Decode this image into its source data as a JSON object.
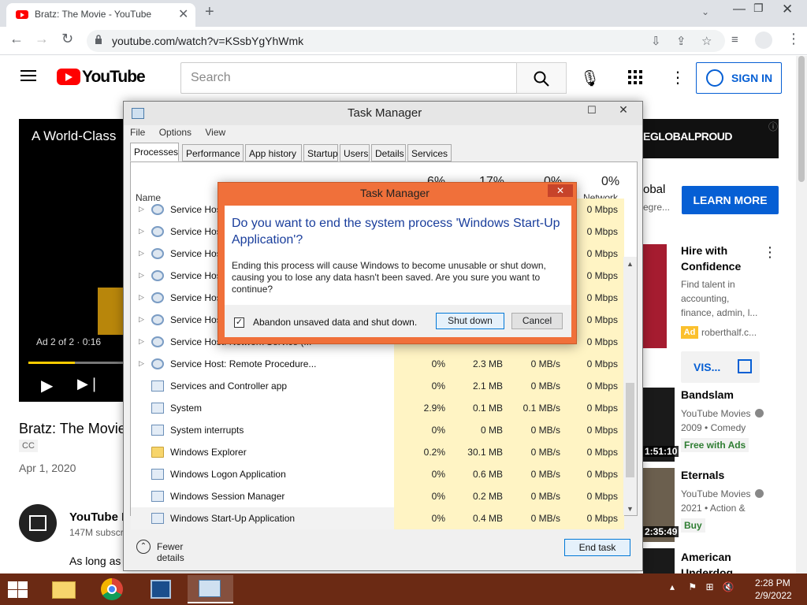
{
  "browser": {
    "tab_title": "Bratz: The Movie - YouTube",
    "url": "youtube.com/watch?v=KSsbYgYhWmk"
  },
  "youtube": {
    "wordmark": "YouTube",
    "search_placeholder": "Search",
    "sign_in": "SIGN IN",
    "player": {
      "ad_title": "A World-Class",
      "ad_counter": "Ad 2 of 2 · 0:16",
      "progress": 0.48
    },
    "video_title": "Bratz: The Movie",
    "cc_badge": "CC",
    "date": "Apr 1, 2020",
    "channel": {
      "name": "YouTube M",
      "subs": "147M subscr"
    },
    "description": "As long as",
    "banner_text": "EGLOBALPROUD",
    "banner_ad": {
      "line1": "obal",
      "line2": "egre...",
      "cta": "LEARN MORE"
    },
    "side_ad": {
      "title": "Hire with Confidence",
      "desc": "Find talent in accounting, finance, admin, l...",
      "badge": "Ad",
      "domain": "roberthalf.c...",
      "visit": "VIS..."
    },
    "recommendations": [
      {
        "title": "Bandslam",
        "channel": "YouTube Movies",
        "meta": "2009 • Comedy",
        "badge": "Free with Ads",
        "duration": "1:51:10"
      },
      {
        "title": "Eternals",
        "channel": "YouTube Movies",
        "meta": "2021 • Action &",
        "badge": "Buy",
        "duration": "2:35:49"
      },
      {
        "title": "American Underdog",
        "channel": "",
        "meta": "",
        "badge": "",
        "duration": ""
      }
    ]
  },
  "task_manager": {
    "title": "Task Manager",
    "menu": [
      "File",
      "Options",
      "View"
    ],
    "tabs": [
      "Processes",
      "Performance",
      "App history",
      "Startup",
      "Users",
      "Details",
      "Services"
    ],
    "columns": {
      "name": "Name",
      "cpu_pct": "6%",
      "mem_pct": "17%",
      "disk_pct": "0%",
      "net_pct": "0%",
      "net_label": "Network"
    },
    "rows": [
      {
        "name": "Service Host: ...",
        "cpu": "",
        "mem": "",
        "disk": "",
        "net": "0 Mbps",
        "icon": "gear",
        "expand": true
      },
      {
        "name": "Service Host: ...",
        "cpu": "",
        "mem": "",
        "disk": "",
        "net": "0 Mbps",
        "icon": "gear",
        "expand": true
      },
      {
        "name": "Service Host: ...",
        "cpu": "",
        "mem": "",
        "disk": "",
        "net": "0 Mbps",
        "icon": "gear",
        "expand": true
      },
      {
        "name": "Service Host: ...",
        "cpu": "",
        "mem": "",
        "disk": "",
        "net": "0 Mbps",
        "icon": "gear",
        "expand": true
      },
      {
        "name": "Service Host: ...",
        "cpu": "",
        "mem": "",
        "disk": "",
        "net": "0 Mbps",
        "icon": "gear",
        "expand": true
      },
      {
        "name": "Service Host: ...",
        "cpu": "",
        "mem": "",
        "disk": "",
        "net": "0 Mbps",
        "icon": "gear",
        "expand": true
      },
      {
        "name": "Service Host: Network Service (...",
        "cpu": "",
        "mem": "",
        "disk": "",
        "net": "0 Mbps",
        "icon": "gear",
        "expand": true
      },
      {
        "name": "Service Host: Remote Procedure...",
        "cpu": "0%",
        "mem": "2.3 MB",
        "disk": "0 MB/s",
        "net": "0 Mbps",
        "icon": "gear",
        "expand": true
      },
      {
        "name": "Services and Controller app",
        "cpu": "0%",
        "mem": "2.1 MB",
        "disk": "0 MB/s",
        "net": "0 Mbps",
        "icon": "app",
        "expand": false
      },
      {
        "name": "System",
        "cpu": "2.9%",
        "mem": "0.1 MB",
        "disk": "0.1 MB/s",
        "net": "0 Mbps",
        "icon": "app",
        "expand": false
      },
      {
        "name": "System interrupts",
        "cpu": "0%",
        "mem": "0 MB",
        "disk": "0 MB/s",
        "net": "0 Mbps",
        "icon": "app",
        "expand": false
      },
      {
        "name": "Windows Explorer",
        "cpu": "0.2%",
        "mem": "30.1 MB",
        "disk": "0 MB/s",
        "net": "0 Mbps",
        "icon": "folder",
        "expand": false
      },
      {
        "name": "Windows Logon Application",
        "cpu": "0%",
        "mem": "0.6 MB",
        "disk": "0 MB/s",
        "net": "0 Mbps",
        "icon": "app",
        "expand": false
      },
      {
        "name": "Windows Session Manager",
        "cpu": "0%",
        "mem": "0.2 MB",
        "disk": "0 MB/s",
        "net": "0 Mbps",
        "icon": "app",
        "expand": false
      },
      {
        "name": "Windows Start-Up Application",
        "cpu": "0%",
        "mem": "0.4 MB",
        "disk": "0 MB/s",
        "net": "0 Mbps",
        "icon": "app",
        "expand": false,
        "selected": true
      }
    ],
    "fewer_details": "Fewer details",
    "end_task": "End task"
  },
  "dialog": {
    "title": "Task Manager",
    "heading": "Do you want to end the system process 'Windows Start-Up Application'?",
    "body": "Ending this process will cause Windows to become unusable or shut down, causing you to lose any data hasn't been saved. Are you sure you want to continue?",
    "checkbox_label": "Abandon unsaved data and shut down.",
    "checkbox_checked": true,
    "confirm": "Shut down",
    "cancel": "Cancel"
  },
  "taskbar": {
    "apps": [
      "file-explorer-icon",
      "chrome-icon",
      "virtualbox-icon",
      "task-manager-icon"
    ],
    "time": "2:28 PM",
    "date": "2/9/2022"
  },
  "colors": {
    "yt_red": "#ff0000",
    "yt_blue": "#065fd4",
    "dialog_frame": "#f0703a",
    "taskbar": "#6b2a14",
    "tm_heat": "#fff4c4"
  }
}
